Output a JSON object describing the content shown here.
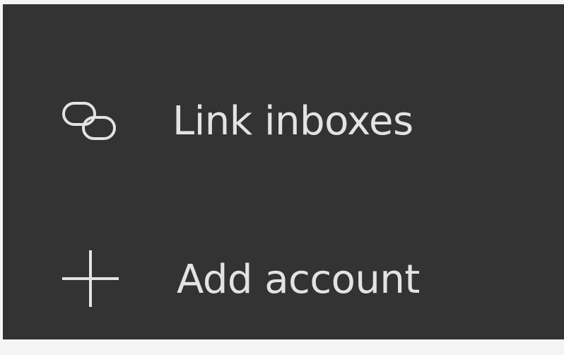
{
  "menu": {
    "items": [
      {
        "label": "Link inboxes",
        "icon": "link-icon"
      },
      {
        "label": "Add account",
        "icon": "plus-icon"
      }
    ]
  },
  "colors": {
    "panel_background": "#333333",
    "text": "#e3e3e3",
    "icon": "#e3e3e3",
    "outer_background": "#f5f5f5"
  }
}
